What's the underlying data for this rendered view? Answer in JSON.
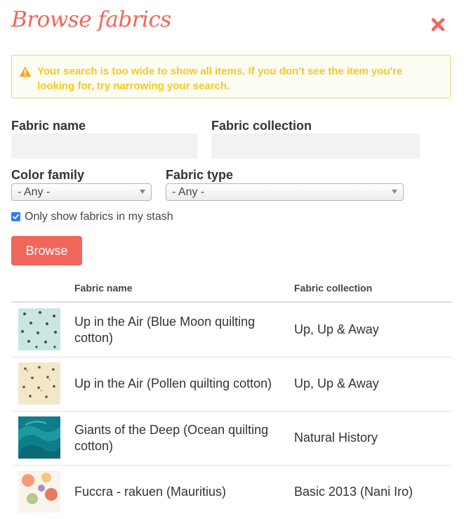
{
  "header": {
    "title": "Browse fabrics"
  },
  "warning": {
    "message": "Your search is too wide to show all items. If you don't see the item you're looking for, try narrowing your search."
  },
  "form": {
    "fabric_name_label": "Fabric name",
    "fabric_name_value": "",
    "fabric_collection_label": "Fabric collection",
    "fabric_collection_value": "",
    "color_family_label": "Color family",
    "color_family_value": "- Any -",
    "fabric_type_label": "Fabric type",
    "fabric_type_value": "- Any -",
    "stash_checkbox_label": "Only show fabrics in my stash",
    "stash_checked": true,
    "browse_label": "Browse"
  },
  "table": {
    "headers": [
      "Fabric name",
      "Fabric collection"
    ],
    "rows": [
      {
        "name": "Up in the Air (Blue Moon quilting cotton)",
        "collection": "Up, Up & Away"
      },
      {
        "name": "Up in the Air (Pollen quilting cotton)",
        "collection": "Up, Up & Away"
      },
      {
        "name": "Giants of the Deep (Ocean quilting cotton)",
        "collection": "Natural History"
      },
      {
        "name": "Fuccra - rakuen (Mauritius)",
        "collection": "Basic 2013 (Nani Iro)"
      }
    ]
  },
  "colors": {
    "accent": "#f0665a",
    "warning_text": "#f5c823",
    "warning_border": "#f5d56b",
    "checkbox": "#2e7cf6"
  },
  "icons": {
    "close": "close-icon",
    "warning": "warning-triangle-icon",
    "dropdown": "chevron-down-icon",
    "checkbox": "check-icon"
  }
}
